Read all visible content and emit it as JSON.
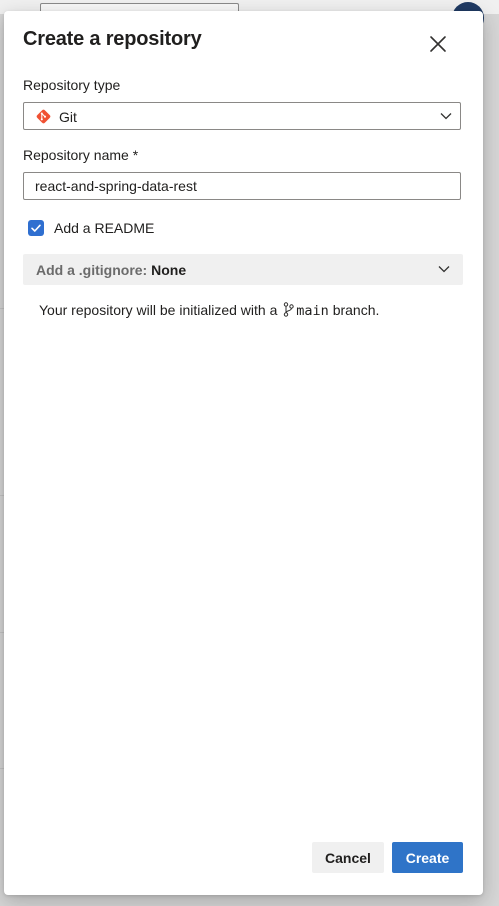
{
  "dialog": {
    "title": "Create a repository"
  },
  "repo_type": {
    "label": "Repository type",
    "value": "Git",
    "icon": "git-icon",
    "icon_color": "#f05133"
  },
  "repo_name": {
    "label": "Repository name *",
    "value": "react-and-spring-data-rest"
  },
  "readme": {
    "label": "Add a README",
    "checked": true
  },
  "gitignore": {
    "label": "Add a .gitignore:",
    "value": "None"
  },
  "info": {
    "prefix": "Your repository will be initialized with a",
    "branch": "main",
    "suffix": "branch."
  },
  "actions": {
    "cancel_label": "Cancel",
    "create_label": "Create"
  },
  "colors": {
    "primary": "#2f74c8",
    "checkbox": "#2f6fd0"
  }
}
